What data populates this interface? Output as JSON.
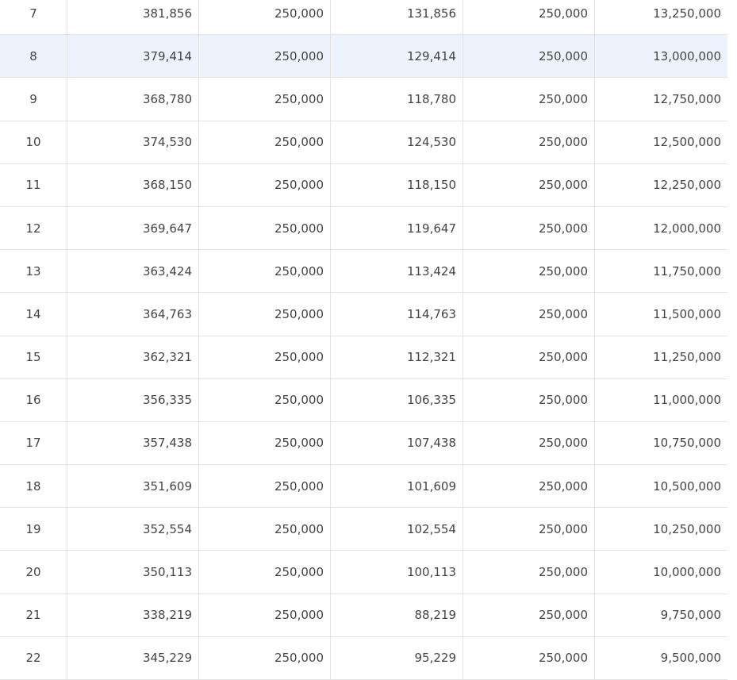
{
  "table": {
    "rows": [
      {
        "no": "7",
        "c1": "381,856",
        "c2": "250,000",
        "c3": "131,856",
        "c4": "250,000",
        "c5": "13,250,000"
      },
      {
        "no": "8",
        "c1": "379,414",
        "c2": "250,000",
        "c3": "129,414",
        "c4": "250,000",
        "c5": "13,000,000"
      },
      {
        "no": "9",
        "c1": "368,780",
        "c2": "250,000",
        "c3": "118,780",
        "c4": "250,000",
        "c5": "12,750,000"
      },
      {
        "no": "10",
        "c1": "374,530",
        "c2": "250,000",
        "c3": "124,530",
        "c4": "250,000",
        "c5": "12,500,000"
      },
      {
        "no": "11",
        "c1": "368,150",
        "c2": "250,000",
        "c3": "118,150",
        "c4": "250,000",
        "c5": "12,250,000"
      },
      {
        "no": "12",
        "c1": "369,647",
        "c2": "250,000",
        "c3": "119,647",
        "c4": "250,000",
        "c5": "12,000,000"
      },
      {
        "no": "13",
        "c1": "363,424",
        "c2": "250,000",
        "c3": "113,424",
        "c4": "250,000",
        "c5": "11,750,000"
      },
      {
        "no": "14",
        "c1": "364,763",
        "c2": "250,000",
        "c3": "114,763",
        "c4": "250,000",
        "c5": "11,500,000"
      },
      {
        "no": "15",
        "c1": "362,321",
        "c2": "250,000",
        "c3": "112,321",
        "c4": "250,000",
        "c5": "11,250,000"
      },
      {
        "no": "16",
        "c1": "356,335",
        "c2": "250,000",
        "c3": "106,335",
        "c4": "250,000",
        "c5": "11,000,000"
      },
      {
        "no": "17",
        "c1": "357,438",
        "c2": "250,000",
        "c3": "107,438",
        "c4": "250,000",
        "c5": "10,750,000"
      },
      {
        "no": "18",
        "c1": "351,609",
        "c2": "250,000",
        "c3": "101,609",
        "c4": "250,000",
        "c5": "10,500,000"
      },
      {
        "no": "19",
        "c1": "352,554",
        "c2": "250,000",
        "c3": "102,554",
        "c4": "250,000",
        "c5": "10,250,000"
      },
      {
        "no": "20",
        "c1": "350,113",
        "c2": "250,000",
        "c3": "100,113",
        "c4": "250,000",
        "c5": "10,000,000"
      },
      {
        "no": "21",
        "c1": "338,219",
        "c2": "250,000",
        "c3": "88,219",
        "c4": "250,000",
        "c5": "9,750,000"
      },
      {
        "no": "22",
        "c1": "345,229",
        "c2": "250,000",
        "c3": "95,229",
        "c4": "250,000",
        "c5": "9,500,000"
      }
    ],
    "highlighted_row_no": "8",
    "colors": {
      "highlight": "#ecf3fc",
      "border": "#e3e3e3",
      "text": "#444444"
    }
  }
}
